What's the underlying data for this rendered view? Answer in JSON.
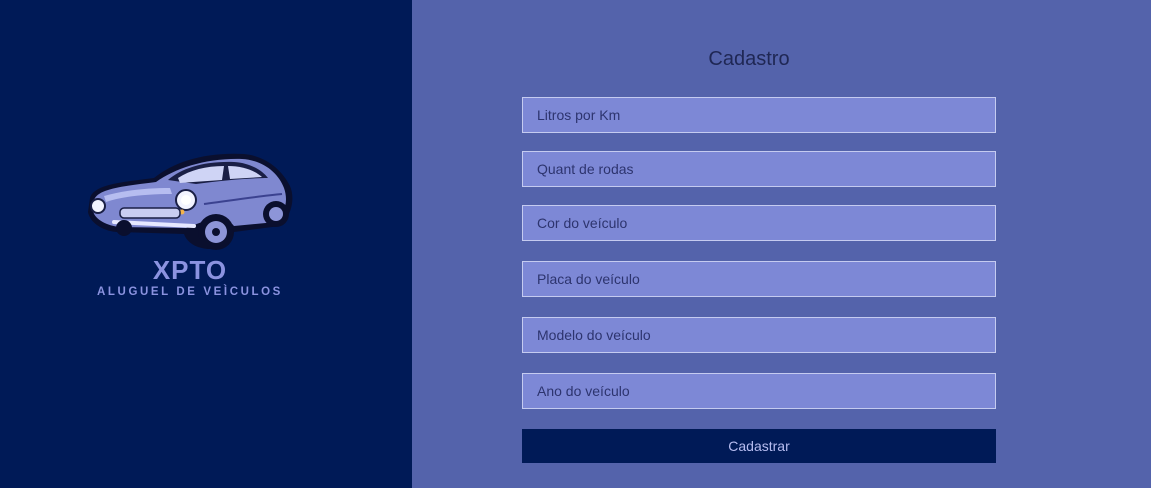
{
  "brand": {
    "name": "XPTO",
    "tagline": "ALUGUEL DE VEÌCULOS",
    "logo_icon": "classic-car-icon"
  },
  "form": {
    "title": "Cadastro",
    "fields": [
      {
        "placeholder": "Litros por Km",
        "value": ""
      },
      {
        "placeholder": "Quant de rodas",
        "value": ""
      },
      {
        "placeholder": "Cor do veículo",
        "value": ""
      },
      {
        "placeholder": "Placa do veículo",
        "value": ""
      },
      {
        "placeholder": "Modelo do veículo",
        "value": ""
      },
      {
        "placeholder": "Ano do veículo",
        "value": ""
      }
    ],
    "submit_label": "Cadastrar"
  },
  "colors": {
    "sidebar_bg": "#001a57",
    "panel_bg": "#5463ab",
    "field_bg": "#7d88d6",
    "button_bg": "#001a57",
    "brand_text": "#8b93e0"
  }
}
